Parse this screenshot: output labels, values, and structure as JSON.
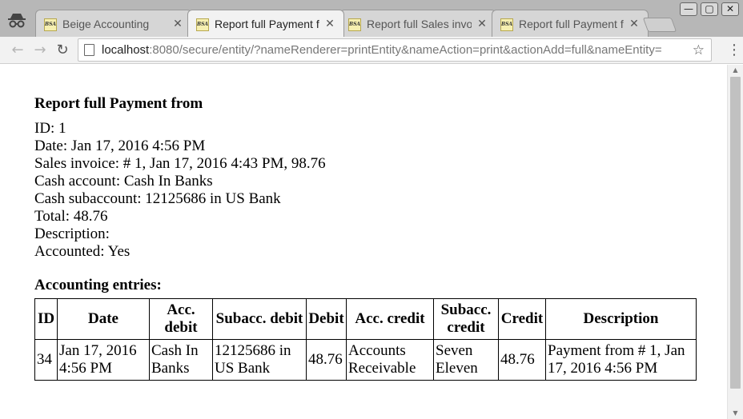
{
  "browser": {
    "tabs": [
      {
        "favicon": "BSA",
        "title": "Beige Accounting",
        "active": false
      },
      {
        "favicon": "BSA",
        "title": "Report full Payment f",
        "active": true
      },
      {
        "favicon": "BSA",
        "title": "Report full Sales invo",
        "active": false
      },
      {
        "favicon": "BSA",
        "title": "Report full Payment f",
        "active": false
      }
    ],
    "url_host": "localhost",
    "url_rest": ":8080/secure/entity/?nameRenderer=printEntity&nameAction=print&actionAdd=full&nameEntity=",
    "icons": {
      "incognito": "incognito-icon",
      "back": "arrow-left-icon",
      "forward": "arrow-right-icon",
      "reload": "reload-icon",
      "bookmark": "star-icon",
      "menu": "kebab-menu-icon"
    },
    "window": {
      "minimize": "—",
      "maximize": "▢",
      "close": "✕"
    }
  },
  "report": {
    "title": "Report full Payment from",
    "fields": [
      "ID: 1",
      "Date: Jan 17, 2016 4:56 PM",
      "Sales invoice: # 1, Jan 17, 2016 4:43 PM, 98.76",
      "Cash account: Cash In Banks",
      "Cash subaccount: 12125686 in US Bank",
      "Total: 48.76",
      "Description:",
      "Accounted: Yes"
    ],
    "entries_title": "Accounting entries:",
    "columns": [
      "ID",
      "Date",
      "Acc. debit",
      "Subacc. debit",
      "Debit",
      "Acc. credit",
      "Subacc. credit",
      "Credit",
      "Description"
    ],
    "rows": [
      [
        "34",
        "Jan 17, 2016 4:56 PM",
        "Cash In Banks",
        "12125686 in US Bank",
        "48.76",
        "Accounts Receivable",
        "Seven Eleven",
        "48.76",
        "Payment from # 1, Jan 17, 2016 4:56 PM"
      ]
    ]
  }
}
